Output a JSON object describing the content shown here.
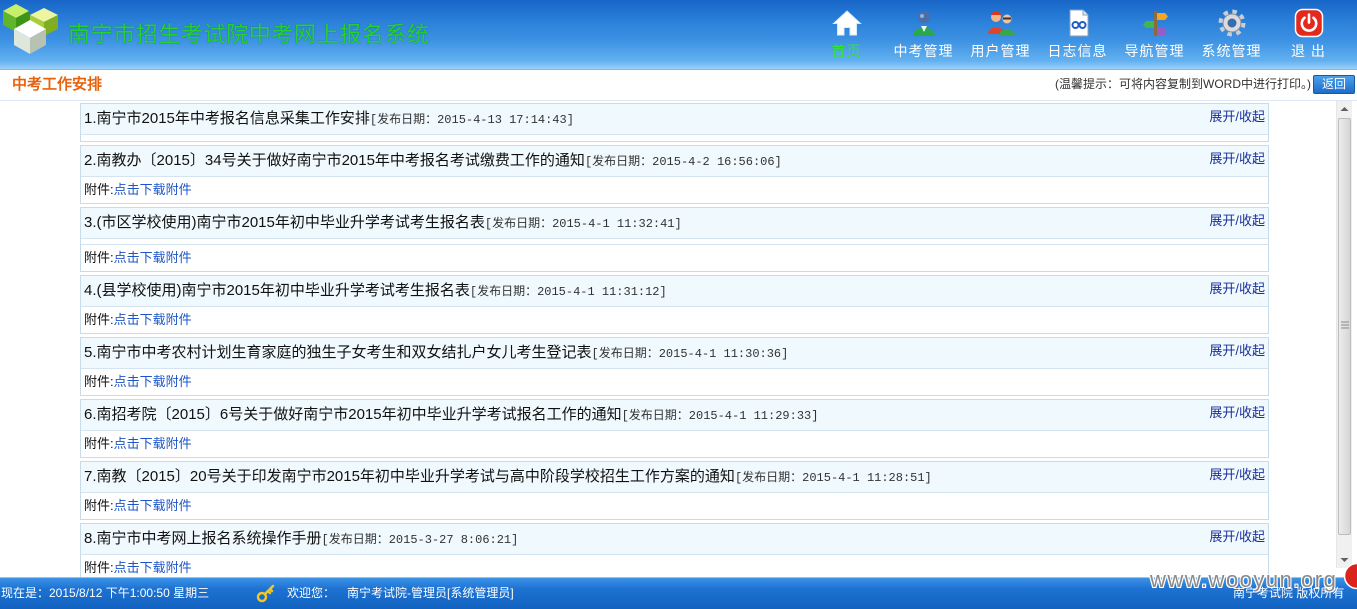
{
  "header": {
    "title": "南宁市招生考试院中考网上报名系统",
    "nav": [
      {
        "label": "首页",
        "icon": "home-icon",
        "active": true
      },
      {
        "label": "中考管理",
        "icon": "exam-user-icon"
      },
      {
        "label": "用户管理",
        "icon": "users-icon"
      },
      {
        "label": "日志信息",
        "icon": "log-document-icon"
      },
      {
        "label": "导航管理",
        "icon": "signpost-icon"
      },
      {
        "label": "系统管理",
        "icon": "gear-icon"
      },
      {
        "label": "退 出",
        "icon": "power-icon"
      }
    ]
  },
  "section": {
    "title": "中考工作安排",
    "hint": "(温馨提示：可将内容复制到WORD中进行打印。)",
    "back_label": "返回"
  },
  "list": {
    "toggle_label": "展开/收起",
    "attachment_label": "附件:",
    "items": [
      {
        "title": "1.南宁市2015年中考报名信息采集工作安排",
        "date": "[发布日期：2015-4-13 17:14:43]"
      },
      {
        "title": "2.南教办〔2015〕34号关于做好南宁市2015年中考报名考试缴费工作的通知",
        "date": "[发布日期：2015-4-2 16:56:06]",
        "attachment": "点击下载附件"
      },
      {
        "title": "3.(市区学校使用)南宁市2015年初中毕业升学考试考生报名表",
        "date": "[发布日期：2015-4-1 11:32:41]",
        "attachment": "点击下载附件"
      },
      {
        "title": "4.(县学校使用)南宁市2015年初中毕业升学考试考生报名表",
        "date": "[发布日期：2015-4-1 11:31:12]",
        "attachment": "点击下载附件"
      },
      {
        "title": "5.南宁市中考农村计划生育家庭的独生子女考生和双女结扎户女儿考生登记表",
        "date": "[发布日期：2015-4-1 11:30:36]",
        "attachment": "点击下载附件"
      },
      {
        "title": "6.南招考院〔2015〕6号关于做好南宁市2015年初中毕业升学考试报名工作的通知",
        "date": "[发布日期：2015-4-1 11:29:33]",
        "attachment": "点击下载附件"
      },
      {
        "title": "7.南教〔2015〕20号关于印发南宁市2015年初中毕业升学考试与高中阶段学校招生工作方案的通知",
        "date": "[发布日期：2015-4-1 11:28:51]",
        "attachment": "点击下载附件"
      },
      {
        "title": "8.南宁市中考网上报名系统操作手册",
        "date": "[发布日期：2015-3-27 8:06:21]",
        "attachment": "点击下载附件"
      }
    ]
  },
  "footer": {
    "datetime": "现在是：2015/8/12 下午1:00:50 星期三",
    "welcome_label": "欢迎您：",
    "user": "南宁考试院-管理员[系统管理员]",
    "copyright": "南宁考试院 版权所有"
  },
  "watermark": "www.wooyun.org",
  "colors": {
    "header_title": "#24d12f",
    "nav_active": "#33e23a",
    "section_title": "#e8620e",
    "toggle_link": "#1b2f9c",
    "attachment_link": "#1d55c8",
    "row_background": "#f0f9fd"
  }
}
